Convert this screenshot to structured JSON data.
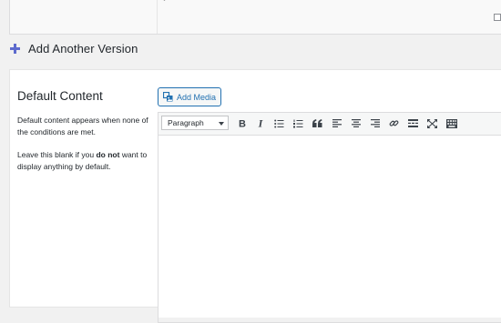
{
  "top_panel": {
    "tick": "ˇ"
  },
  "add_version": {
    "label": "Add Another Version"
  },
  "default_content": {
    "title": "Default Content",
    "description_1": "Default content appears when none of the conditions are met.",
    "description_2_prefix": "Leave this blank if you ",
    "description_2_bold": "do not",
    "description_2_suffix": " want to display anything by default."
  },
  "editor": {
    "add_media_label": "Add Media",
    "format_value": "Paragraph",
    "toolbar_icons": [
      "bold-icon",
      "italic-icon",
      "bullet-list-icon",
      "numbered-list-icon",
      "blockquote-icon",
      "align-left-icon",
      "align-center-icon",
      "align-right-icon",
      "link-icon",
      "read-more-icon",
      "fullscreen-icon",
      "toolbar-toggle-icon"
    ],
    "content": ""
  },
  "colors": {
    "accent": "#2271b1",
    "plus": "#5d6acd"
  }
}
